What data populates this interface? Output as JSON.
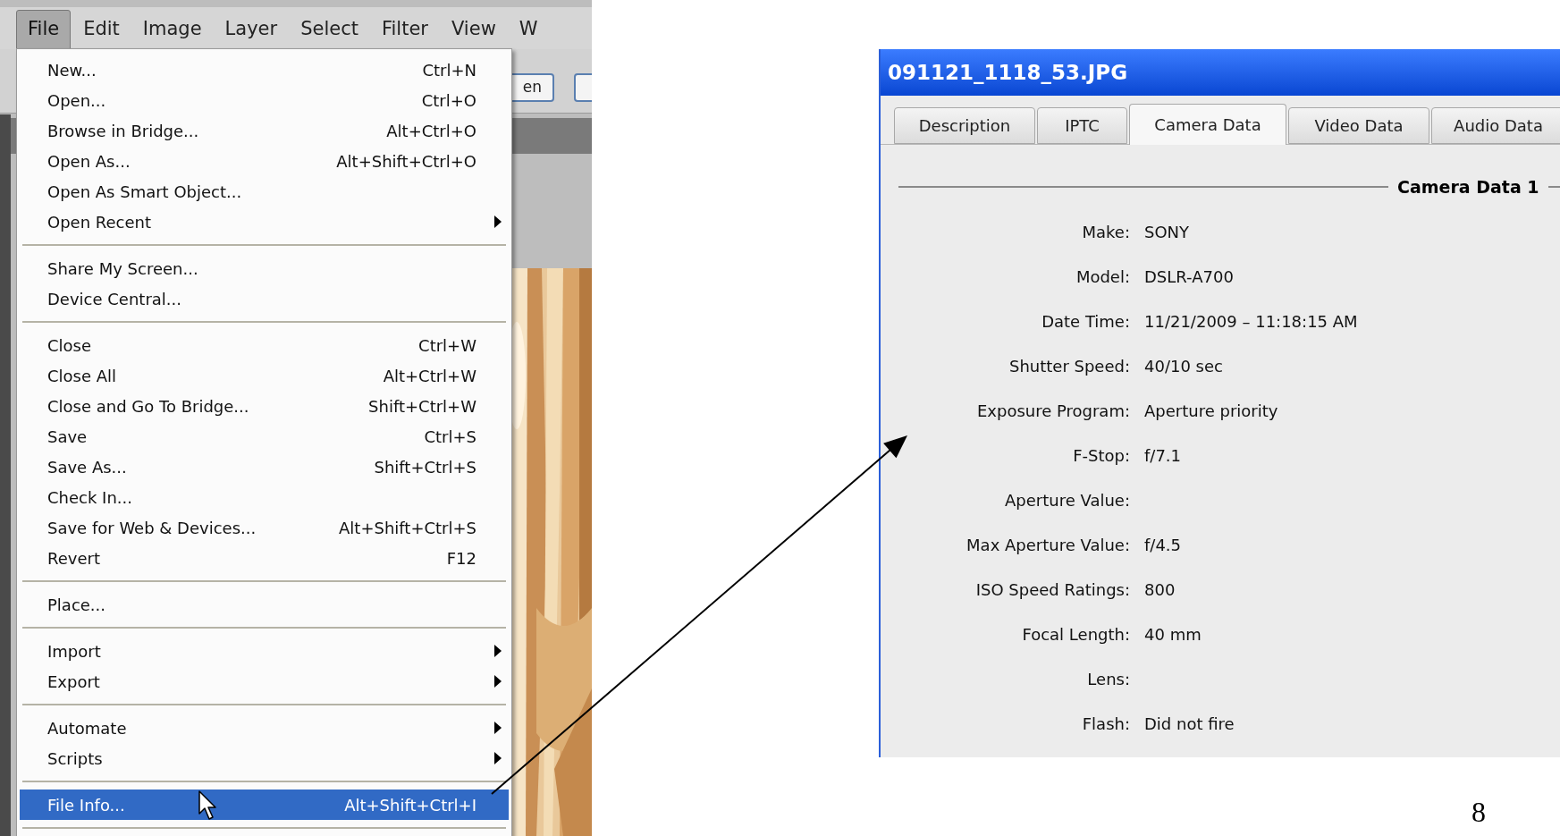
{
  "photoshop": {
    "menubar": [
      {
        "label": "File",
        "selected": true
      },
      {
        "label": "Edit",
        "selected": false
      },
      {
        "label": "Image",
        "selected": false
      },
      {
        "label": "Layer",
        "selected": false
      },
      {
        "label": "Select",
        "selected": false
      },
      {
        "label": "Filter",
        "selected": false
      },
      {
        "label": "View",
        "selected": false
      },
      {
        "label": "W",
        "selected": false
      }
    ],
    "toolbar_button": "en",
    "file_menu": [
      {
        "kind": "item",
        "label": "New...",
        "shortcut": "Ctrl+N",
        "submenu": false,
        "selected": false
      },
      {
        "kind": "item",
        "label": "Open...",
        "shortcut": "Ctrl+O",
        "submenu": false,
        "selected": false
      },
      {
        "kind": "item",
        "label": "Browse in Bridge...",
        "shortcut": "Alt+Ctrl+O",
        "submenu": false,
        "selected": false
      },
      {
        "kind": "item",
        "label": "Open As...",
        "shortcut": "Alt+Shift+Ctrl+O",
        "submenu": false,
        "selected": false
      },
      {
        "kind": "item",
        "label": "Open As Smart Object...",
        "submenu": false,
        "selected": false
      },
      {
        "kind": "item",
        "label": "Open Recent",
        "submenu": true,
        "selected": false
      },
      {
        "kind": "separator"
      },
      {
        "kind": "item",
        "label": "Share My Screen...",
        "submenu": false,
        "selected": false
      },
      {
        "kind": "item",
        "label": "Device Central...",
        "submenu": false,
        "selected": false
      },
      {
        "kind": "separator"
      },
      {
        "kind": "item",
        "label": "Close",
        "shortcut": "Ctrl+W",
        "submenu": false,
        "selected": false
      },
      {
        "kind": "item",
        "label": "Close All",
        "shortcut": "Alt+Ctrl+W",
        "submenu": false,
        "selected": false
      },
      {
        "kind": "item",
        "label": "Close and Go To Bridge...",
        "shortcut": "Shift+Ctrl+W",
        "submenu": false,
        "selected": false
      },
      {
        "kind": "item",
        "label": "Save",
        "shortcut": "Ctrl+S",
        "submenu": false,
        "selected": false
      },
      {
        "kind": "item",
        "label": "Save As...",
        "shortcut": "Shift+Ctrl+S",
        "submenu": false,
        "selected": false
      },
      {
        "kind": "item",
        "label": "Check In...",
        "submenu": false,
        "selected": false
      },
      {
        "kind": "item",
        "label": "Save for Web & Devices...",
        "shortcut": "Alt+Shift+Ctrl+S",
        "submenu": false,
        "selected": false
      },
      {
        "kind": "item",
        "label": "Revert",
        "shortcut": "F12",
        "submenu": false,
        "selected": false
      },
      {
        "kind": "separator"
      },
      {
        "kind": "item",
        "label": "Place...",
        "submenu": false,
        "selected": false
      },
      {
        "kind": "separator"
      },
      {
        "kind": "item",
        "label": "Import",
        "submenu": true,
        "selected": false
      },
      {
        "kind": "item",
        "label": "Export",
        "submenu": true,
        "selected": false
      },
      {
        "kind": "separator"
      },
      {
        "kind": "item",
        "label": "Automate",
        "submenu": true,
        "selected": false
      },
      {
        "kind": "item",
        "label": "Scripts",
        "submenu": true,
        "selected": false
      },
      {
        "kind": "separator"
      },
      {
        "kind": "item",
        "label": "File Info...",
        "shortcut": "Alt+Shift+Ctrl+I",
        "submenu": false,
        "selected": true
      },
      {
        "kind": "separator"
      }
    ]
  },
  "file_info": {
    "title": "091121_1118_53.JPG",
    "tabs": [
      {
        "label": "Description",
        "selected": false
      },
      {
        "label": "IPTC",
        "selected": false
      },
      {
        "label": "Camera Data",
        "selected": true
      },
      {
        "label": "Video Data",
        "selected": false
      },
      {
        "label": "Audio Data",
        "selected": false
      }
    ],
    "section": "Camera Data 1",
    "fields": [
      {
        "label": "Make:",
        "value": "SONY"
      },
      {
        "label": "Model:",
        "value": "DSLR-A700"
      },
      {
        "label": "Date Time:",
        "value": "11/21/2009 – 11:18:15 AM"
      },
      {
        "label": "Shutter Speed:",
        "value": "40/10 sec"
      },
      {
        "label": "Exposure Program:",
        "value": "Aperture priority"
      },
      {
        "label": "F-Stop:",
        "value": "f/7.1"
      },
      {
        "label": "Aperture Value:"
      },
      {
        "label": "Max Aperture Value:",
        "value": "f/4.5"
      },
      {
        "label": "ISO Speed Ratings:",
        "value": "800"
      },
      {
        "label": "Focal Length:",
        "value": "40 mm"
      },
      {
        "label": "Lens:"
      },
      {
        "label": "Flash:",
        "value": "Did not fire"
      }
    ]
  },
  "page_number": "8"
}
